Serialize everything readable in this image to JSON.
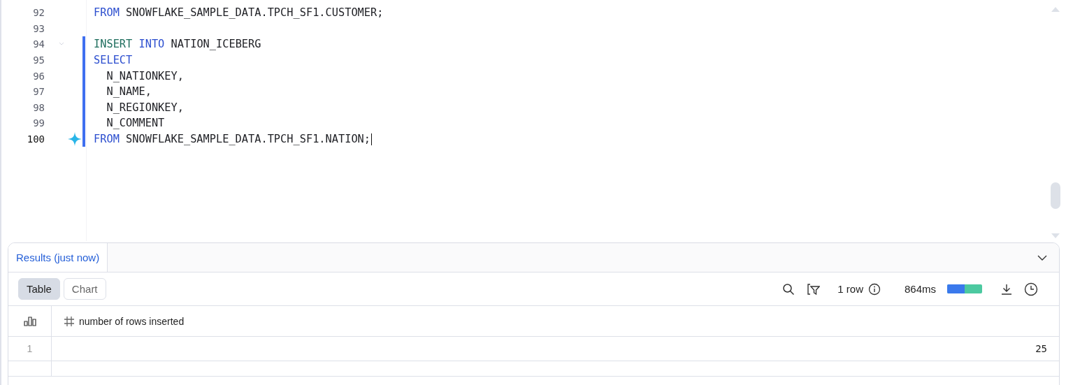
{
  "editor": {
    "lines": [
      {
        "number": "92",
        "active": false,
        "changed": false,
        "folder": false,
        "sparkle": false,
        "tokens": [
          {
            "text": "FROM",
            "kind": "keyword"
          },
          {
            "text": " SNOWFLAKE_SAMPLE_DATA.TPCH_SF1.CUSTOMER;",
            "kind": "ident"
          }
        ]
      },
      {
        "number": "93",
        "active": false,
        "changed": false,
        "folder": false,
        "sparkle": false
      },
      {
        "number": "94",
        "active": false,
        "changed": true,
        "folder": true,
        "sparkle": false,
        "tokens": [
          {
            "text": "INSERT",
            "kind": "dml"
          },
          {
            "text": " INTO",
            "kind": "keyword"
          },
          {
            "text": " NATION_ICEBERG",
            "kind": "ident"
          }
        ]
      },
      {
        "number": "95",
        "active": false,
        "changed": true,
        "folder": false,
        "sparkle": false,
        "tokens": [
          {
            "text": "SELECT",
            "kind": "keyword"
          }
        ]
      },
      {
        "number": "96",
        "active": false,
        "changed": true,
        "folder": false,
        "sparkle": false,
        "tokens": [
          {
            "text": "  N_NATIONKEY,",
            "kind": "ident"
          }
        ]
      },
      {
        "number": "97",
        "active": false,
        "changed": true,
        "folder": false,
        "sparkle": false,
        "tokens": [
          {
            "text": "  N_NAME,",
            "kind": "ident"
          }
        ]
      },
      {
        "number": "98",
        "active": false,
        "changed": true,
        "folder": false,
        "sparkle": false,
        "tokens": [
          {
            "text": "  N_REGIONKEY,",
            "kind": "ident"
          }
        ]
      },
      {
        "number": "99",
        "active": false,
        "changed": true,
        "folder": false,
        "sparkle": false,
        "tokens": [
          {
            "text": "  N_COMMENT",
            "kind": "ident"
          }
        ]
      },
      {
        "number": "100",
        "active": true,
        "changed": true,
        "folder": false,
        "sparkle": true,
        "tokens": [
          {
            "text": "FROM",
            "kind": "keyword"
          },
          {
            "text": " SNOWFLAKE_SAMPLE_DATA.TPCH_SF1.NATION;",
            "kind": "ident"
          }
        ]
      }
    ]
  },
  "results": {
    "tabs": [
      {
        "label": "Results (just now)",
        "selected": true
      }
    ],
    "views": [
      {
        "label": "Table",
        "selected": true
      },
      {
        "label": "Chart",
        "selected": false
      }
    ],
    "row_count": "1 row",
    "duration": "864ms",
    "timing": {
      "level": 0.5
    },
    "table": {
      "columns": [
        {
          "label": "number of rows inserted",
          "kind": "number"
        }
      ],
      "rows": [
        {
          "index": "1",
          "cells": [
            "25"
          ]
        }
      ]
    }
  }
}
